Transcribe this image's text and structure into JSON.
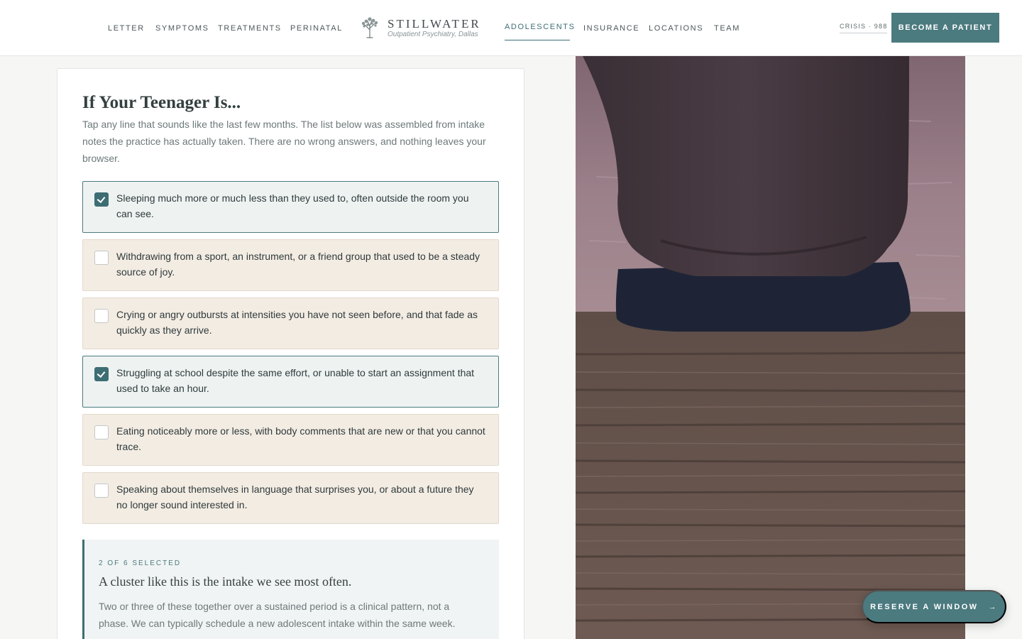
{
  "header": {
    "nav_left": [
      "LETTER",
      "SYMPTOMS",
      "TREATMENTS",
      "PERINATAL"
    ],
    "logo_name": "STILLWATER",
    "logo_tagline": "Outpatient Psychiatry, Dallas",
    "nav_right": [
      "ADOLESCENTS",
      "INSURANCE",
      "LOCATIONS",
      "TEAM"
    ],
    "active_nav": "ADOLESCENTS",
    "crisis_link": "CRISIS · 988",
    "cta_label": "BECOME A PATIENT"
  },
  "checklist": {
    "title": "If Your Teenager Is...",
    "intro": "Tap any line that sounds like the last few months. The list below was assembled from intake notes the practice has actually taken. There are no wrong answers, and nothing leaves your browser.",
    "items": [
      {
        "text": "Sleeping much more or much less than they used to, often outside the room you can see.",
        "checked": true
      },
      {
        "text": "Withdrawing from a sport, an instrument, or a friend group that used to be a steady source of joy.",
        "checked": false
      },
      {
        "text": "Crying or angry outbursts at intensities you have not seen before, and that fade as quickly as they arrive.",
        "checked": false
      },
      {
        "text": "Struggling at school despite the same effort, or unable to start an assignment that used to take an hour.",
        "checked": true
      },
      {
        "text": "Eating noticeably more or less, with body comments that are new or that you cannot trace.",
        "checked": false
      },
      {
        "text": "Speaking about themselves in language that surprises you, or about a future they no longer sound interested in.",
        "checked": false
      }
    ],
    "result": {
      "count_label": "2 OF 6 SELECTED",
      "heading": "A cluster like this is the intake we see most often.",
      "body": "Two or three of these together over a sustained period is a clinical pattern, not a phase. We can typically schedule a new adolescent intake within the same week."
    }
  },
  "floating_cta": {
    "label": "RESERVE A WINDOW",
    "arrow": "→"
  },
  "colors": {
    "accent": "#4b7a7f",
    "accent_dark": "#3d6e74",
    "option_bg": "#f3ece3",
    "option_checked_bg": "#eef3f2"
  }
}
